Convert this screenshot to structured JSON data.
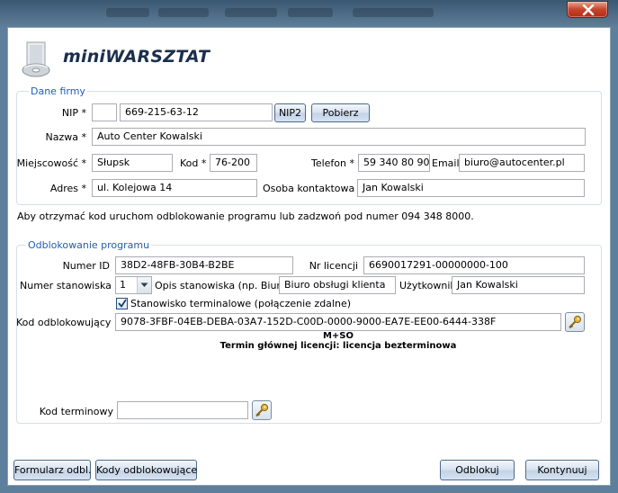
{
  "window": {
    "close_icon": "close-icon"
  },
  "app": {
    "logo_text": "miniWARSZTAT",
    "logo_icon": "cd-software-icon"
  },
  "company": {
    "legend": "Dane firmy",
    "nip_label": "NIP *",
    "nip_prefix": "",
    "nip_value": "669-215-63-12",
    "nip2_button": "NIP2",
    "fetch_button": "Pobierz",
    "name_label": "Nazwa *",
    "name_value": "Auto Center Kowalski",
    "city_label": "Miejscowość *",
    "city_value": "Słupsk",
    "postcode_label": "Kod *",
    "postcode_value": "76-200",
    "phone_label": "Telefon *",
    "phone_value": "59 340  80 90",
    "email_label": "Email",
    "email_value": "biuro@autocenter.pl",
    "address_label": "Adres *",
    "address_value": "ul. Kolejowa 14",
    "contact_label": "Osoba kontaktowa",
    "contact_value": "Jan Kowalski"
  },
  "info_text": "Aby otrzymać kod uruchom odblokowanie programu lub zadzwoń pod numer 094 348 8000.",
  "unlock": {
    "legend": "Odblokowanie programu",
    "id_label": "Numer ID",
    "id_value": "38D2-48FB-30B4-B2BE",
    "license_label": "Nr licencji",
    "license_value": "6690017291-00000000-100",
    "station_label": "Numer stanowiska",
    "station_value": "1",
    "station_desc_label": "Opis stanowiska (np. Biuro)",
    "station_desc_value": "Biuro obsługi klienta",
    "user_label": "Użytkownik",
    "user_value": "Jan Kowalski",
    "terminal_checkbox_label": "Stanowisko terminalowe (połączenie zdalne)",
    "terminal_checked": true,
    "code_label": "Kod odblokowujący",
    "code_value": "9078-3FBF-04EB-DEBA-03A7-152D-C00D-0000-9000-EA7E-EE00-6444-338F",
    "mode_text": "M+SO",
    "term_text": "Termin głównej licencji: licencja bezterminowa",
    "term_code_label": "Kod terminowy",
    "term_code_value": ""
  },
  "buttons": {
    "form": "Formularz odbl.",
    "codes": "Kody odblokowujące",
    "unlock": "Odblokuj",
    "continue": "Kontynuuj"
  }
}
